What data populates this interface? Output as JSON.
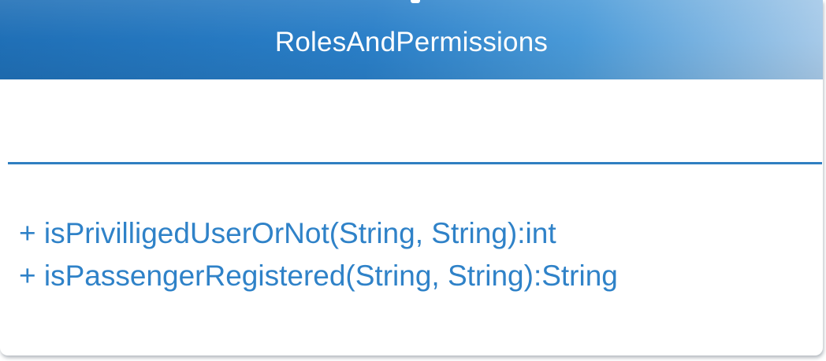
{
  "uml_class": {
    "name": "RolesAndPermissions",
    "attributes": [],
    "operations": [
      "+ isPrivilligedUserOrNot(String, String):int",
      "+ isPassengerRegistered(String, String):String"
    ]
  },
  "colors": {
    "header_start": "#1f6fb6",
    "header_end": "#a9cbe9",
    "divider": "#2f7fc1",
    "operation_text": "#2f82c8",
    "title_text": "#ffffff"
  }
}
